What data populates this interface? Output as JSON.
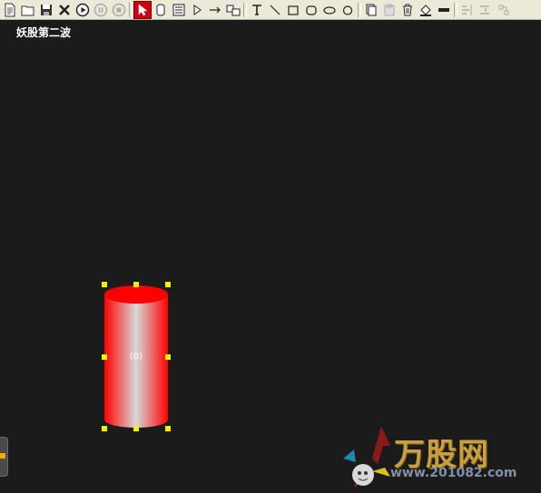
{
  "toolbar": {
    "buttons": [
      {
        "name": "new-icon"
      },
      {
        "name": "open-folder-icon"
      },
      {
        "name": "save-icon"
      },
      {
        "name": "close-icon"
      },
      {
        "name": "play-icon"
      },
      {
        "name": "pause-icon"
      },
      {
        "name": "stop-icon"
      },
      {
        "name": "select-arrow-icon"
      },
      {
        "name": "cylinder-icon"
      },
      {
        "name": "text-box-icon"
      },
      {
        "name": "triangle-arrow-icon"
      },
      {
        "name": "arrow-icon"
      },
      {
        "name": "image-icon"
      },
      {
        "name": "text-tool-icon"
      },
      {
        "name": "line-icon"
      },
      {
        "name": "rectangle-icon"
      },
      {
        "name": "rounded-rectangle-icon"
      },
      {
        "name": "ellipse-icon"
      },
      {
        "name": "circle-icon"
      },
      {
        "name": "copy-icon"
      },
      {
        "name": "paste-icon"
      },
      {
        "name": "delete-icon"
      },
      {
        "name": "fill-color-icon"
      },
      {
        "name": "line-style-icon"
      },
      {
        "name": "align-icon"
      },
      {
        "name": "distribute-icon"
      },
      {
        "name": "group-icon"
      }
    ]
  },
  "canvas": {
    "title": "妖股第二波",
    "cylinder": {
      "label": "(0)",
      "color": "#ff0000",
      "highlight": "#d6d6d6"
    }
  },
  "watermark": {
    "brand": "万股网",
    "url": "www.201082.com"
  },
  "colors": {
    "background": "#1b1b1b",
    "toolbar": "#ece9d8",
    "active_tool": "#d0000e",
    "handle": "#f5f000"
  }
}
